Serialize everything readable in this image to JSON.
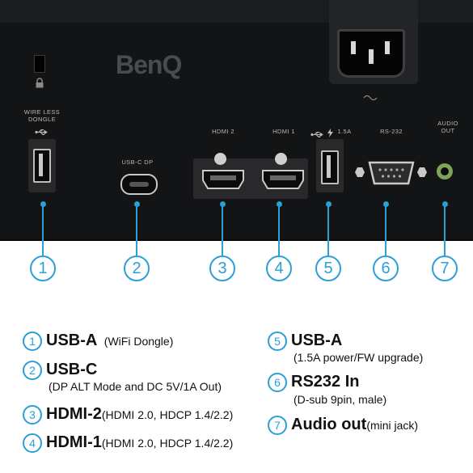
{
  "panel": {
    "brand": "BenQ",
    "labels": {
      "wireless_dongle_line1": "WIRE LESS",
      "wireless_dongle_line2": "DONGLE",
      "usbc": "USB-C DP",
      "hdmi2": "HDMI 2",
      "hdmi1": "HDMI 1",
      "usb_power": "1.5A",
      "rs232": "RS-232",
      "audio_line1": "AUDIO",
      "audio_line2": "OUT"
    },
    "accent_color": "#2a9fd8",
    "panel_color": "#131415"
  },
  "callouts": [
    "1",
    "2",
    "3",
    "4",
    "5",
    "6",
    "7"
  ],
  "legend": {
    "items": [
      {
        "num": "1",
        "title": "USB-A",
        "detail": "(WiFi Dongle)",
        "second_line": ""
      },
      {
        "num": "2",
        "title": "USB-C",
        "detail": "",
        "second_line": "(DP ALT Mode and DC 5V/1A Out)"
      },
      {
        "num": "3",
        "title": "HDMI-2",
        "detail": "(HDMI 2.0, HDCP 1.4/2.2)",
        "second_line": ""
      },
      {
        "num": "4",
        "title": "HDMI-1",
        "detail": "(HDMI 2.0, HDCP 1.4/2.2)",
        "second_line": ""
      },
      {
        "num": "5",
        "title": "USB-A",
        "detail": "",
        "second_line": "(1.5A power/FW upgrade)"
      },
      {
        "num": "6",
        "title": "RS232 In",
        "detail": "",
        "second_line": "(D-sub 9pin, male)"
      },
      {
        "num": "7",
        "title": "Audio out",
        "detail": "(mini jack)",
        "second_line": ""
      }
    ]
  }
}
